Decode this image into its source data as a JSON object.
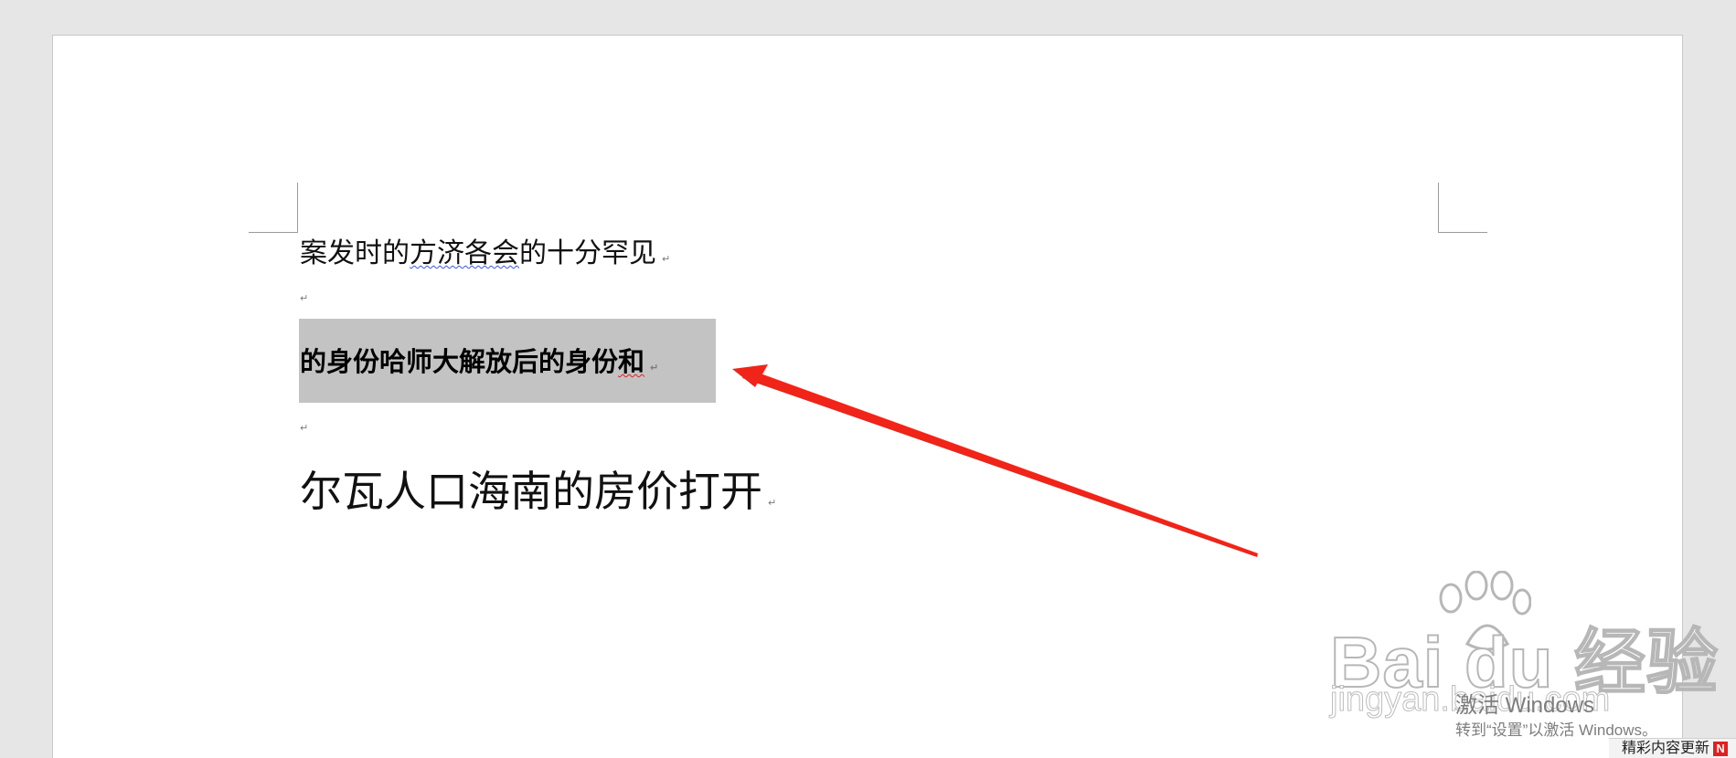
{
  "document": {
    "line1": {
      "before": "案发时的",
      "squiggle": "方济各会",
      "after": "的十分罕见"
    },
    "line2": {
      "before": "的身份哈师大解放后的身份",
      "squiggle": "和"
    },
    "line3": "尔瓦人口海南的房价打开",
    "paragraph_mark": "↵"
  },
  "watermark": {
    "brand": "Bai du 经验",
    "url": "jingyan.baidu.com"
  },
  "activation": {
    "title": "激活 Windows",
    "subtitle": "转到“设置”以激活 Windows。"
  },
  "news": {
    "label": "精彩内容更新",
    "icon": "N"
  },
  "colors": {
    "arrow": "#f02418",
    "selection": "#c3c3c3",
    "spell_blue": "#3b55e6",
    "spell_red": "#e02020"
  }
}
